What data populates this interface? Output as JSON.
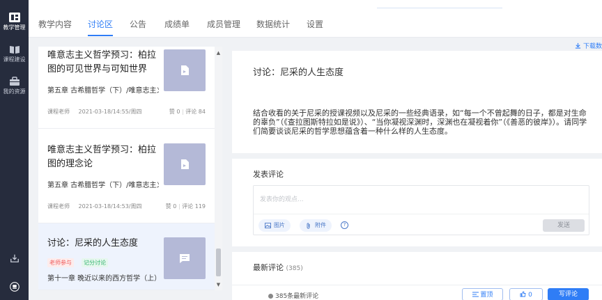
{
  "sidebar": {
    "items": [
      {
        "label": "教学管理",
        "icon": "teaching-management-icon",
        "active": true
      },
      {
        "label": "课程建设",
        "icon": "book-icon",
        "active": false
      },
      {
        "label": "我的资源",
        "icon": "briefcase-icon",
        "active": false
      }
    ],
    "bottom_icons": [
      "download-icon",
      "avatar-icon"
    ]
  },
  "tabs": [
    "教学内容",
    "讨论区",
    "公告",
    "成绩单",
    "成员管理",
    "数据统计",
    "设置"
  ],
  "active_tab": "讨论区",
  "download_label": "下载数",
  "topics": [
    {
      "title": "唯意志主义哲学预习：柏拉图的可见世界与可知世界",
      "chapter": "第五章 古希腊哲学（下）/唯意志主义哲学",
      "author": "课程老师",
      "time": "2021-03-18/14:55/周四",
      "likes": "赞 0",
      "comments": "评论 84",
      "thumb_icon": "document-icon"
    },
    {
      "title": "唯意志主义哲学预习：柏拉图的理念论",
      "chapter": "第五章 古希腊哲学（下）/唯意志主义哲学",
      "author": "课程老师",
      "time": "2021-03-18/14:53/周四",
      "likes": "赞 0",
      "comments": "评论 119",
      "thumb_icon": "document-icon"
    },
    {
      "title": "讨论：尼采的人生态度",
      "tags": [
        "老师参与",
        "记分讨论"
      ],
      "chapter": "第十一章 晚近以来的西方哲学（上）",
      "thumb_icon": "message-icon",
      "selected": true
    }
  ],
  "detail": {
    "title": "讨论：尼采的人生态度",
    "body": "结合收看的关于尼采的授课视频以及尼采的一些经典语录，如“每一个不曾起舞的日子，都是对生命的辜负”（《查拉图斯特拉如是说》）、“当你凝视深渊时，深渊也在凝视着你”（《善恶的彼岸》）。请同学们简要谈谈尼采的哲学思想蕴含着一种什么样的人生态度。"
  },
  "comment_form": {
    "title": "发表评论",
    "placeholder": "发表你的观点...",
    "image_label": "图片",
    "attach_label": "附件",
    "help": "?",
    "send_label": "发送"
  },
  "latest": {
    "title": "最新评论",
    "count": "(385)"
  },
  "bottom_bar": {
    "count_label": "385条最新评论",
    "pin_label": "置顶",
    "like_label": "0",
    "write_label": "写评论"
  },
  "colors": {
    "accent": "#2f7df6",
    "rail": "#262c3d",
    "thumb": "#b4b9d7",
    "tag_red": "#f05a5a",
    "tag_green": "#2fb36b"
  }
}
